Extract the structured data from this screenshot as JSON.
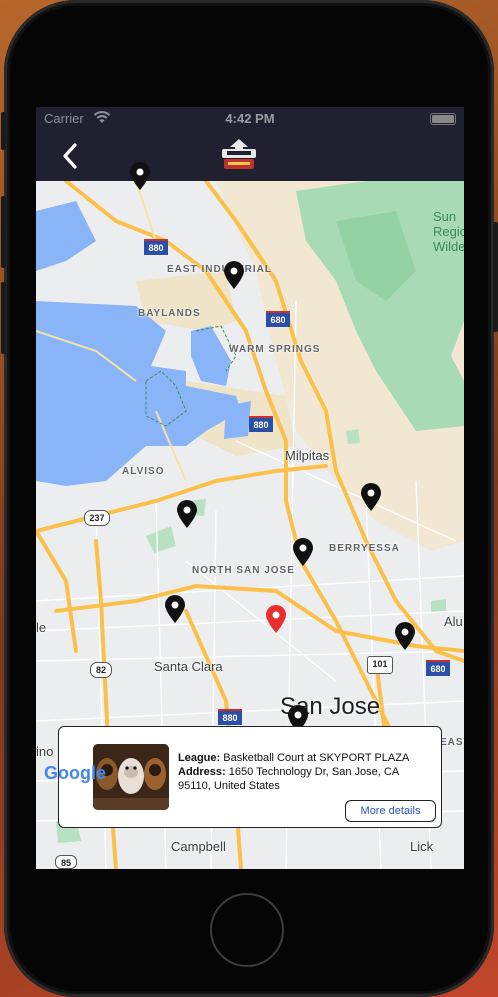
{
  "status_bar": {
    "carrier": "Carrier",
    "time": "4:42 PM"
  },
  "navbar": {
    "back_icon": "chevron-left-icon",
    "logo_icon": "village-sports-logo"
  },
  "map": {
    "area_labels": {
      "east_industrial": "EAST INDUSTRIAL",
      "baylands": "BAYLANDS",
      "warm_springs": "WARM SPRINGS",
      "alviso": "ALVISO",
      "berryessa": "BERRYESSA",
      "north_san_jose": "NORTH SAN JOSE",
      "east": "EAST"
    },
    "cities": {
      "milpitas": "Milpitas",
      "santa_clara": "Santa Clara",
      "san_jose": "San Jose",
      "campbell": "Campbell",
      "lick": "Lick",
      "alum": "Alu",
      "le": "le",
      "ino": "ino"
    },
    "park_label": [
      "Sun",
      "Regio",
      "Wilderr"
    ],
    "highway_shields": {
      "i880_north": "880",
      "i680_a": "680",
      "i880_mid": "880",
      "sr237": "237",
      "sr82": "82",
      "us101": "101",
      "i680_b": "680",
      "i880_south": "880",
      "sr85": "85"
    },
    "attribution": "Google"
  },
  "card": {
    "league_label": "League:",
    "league_value": "Basketball Court at SKYPORT PLAZA",
    "address_label": "Address:",
    "address_value": "1650 Technology Dr, San Jose, CA 95110, United States",
    "details_button": "More details"
  },
  "colors": {
    "navbar": "#1f2131",
    "water": "#8ab4f8",
    "park": "#a8dab5",
    "highway": "#fbc04a",
    "selected_pin": "#ea2d2d",
    "pin": "#111111",
    "button_text": "#2b54c8"
  }
}
